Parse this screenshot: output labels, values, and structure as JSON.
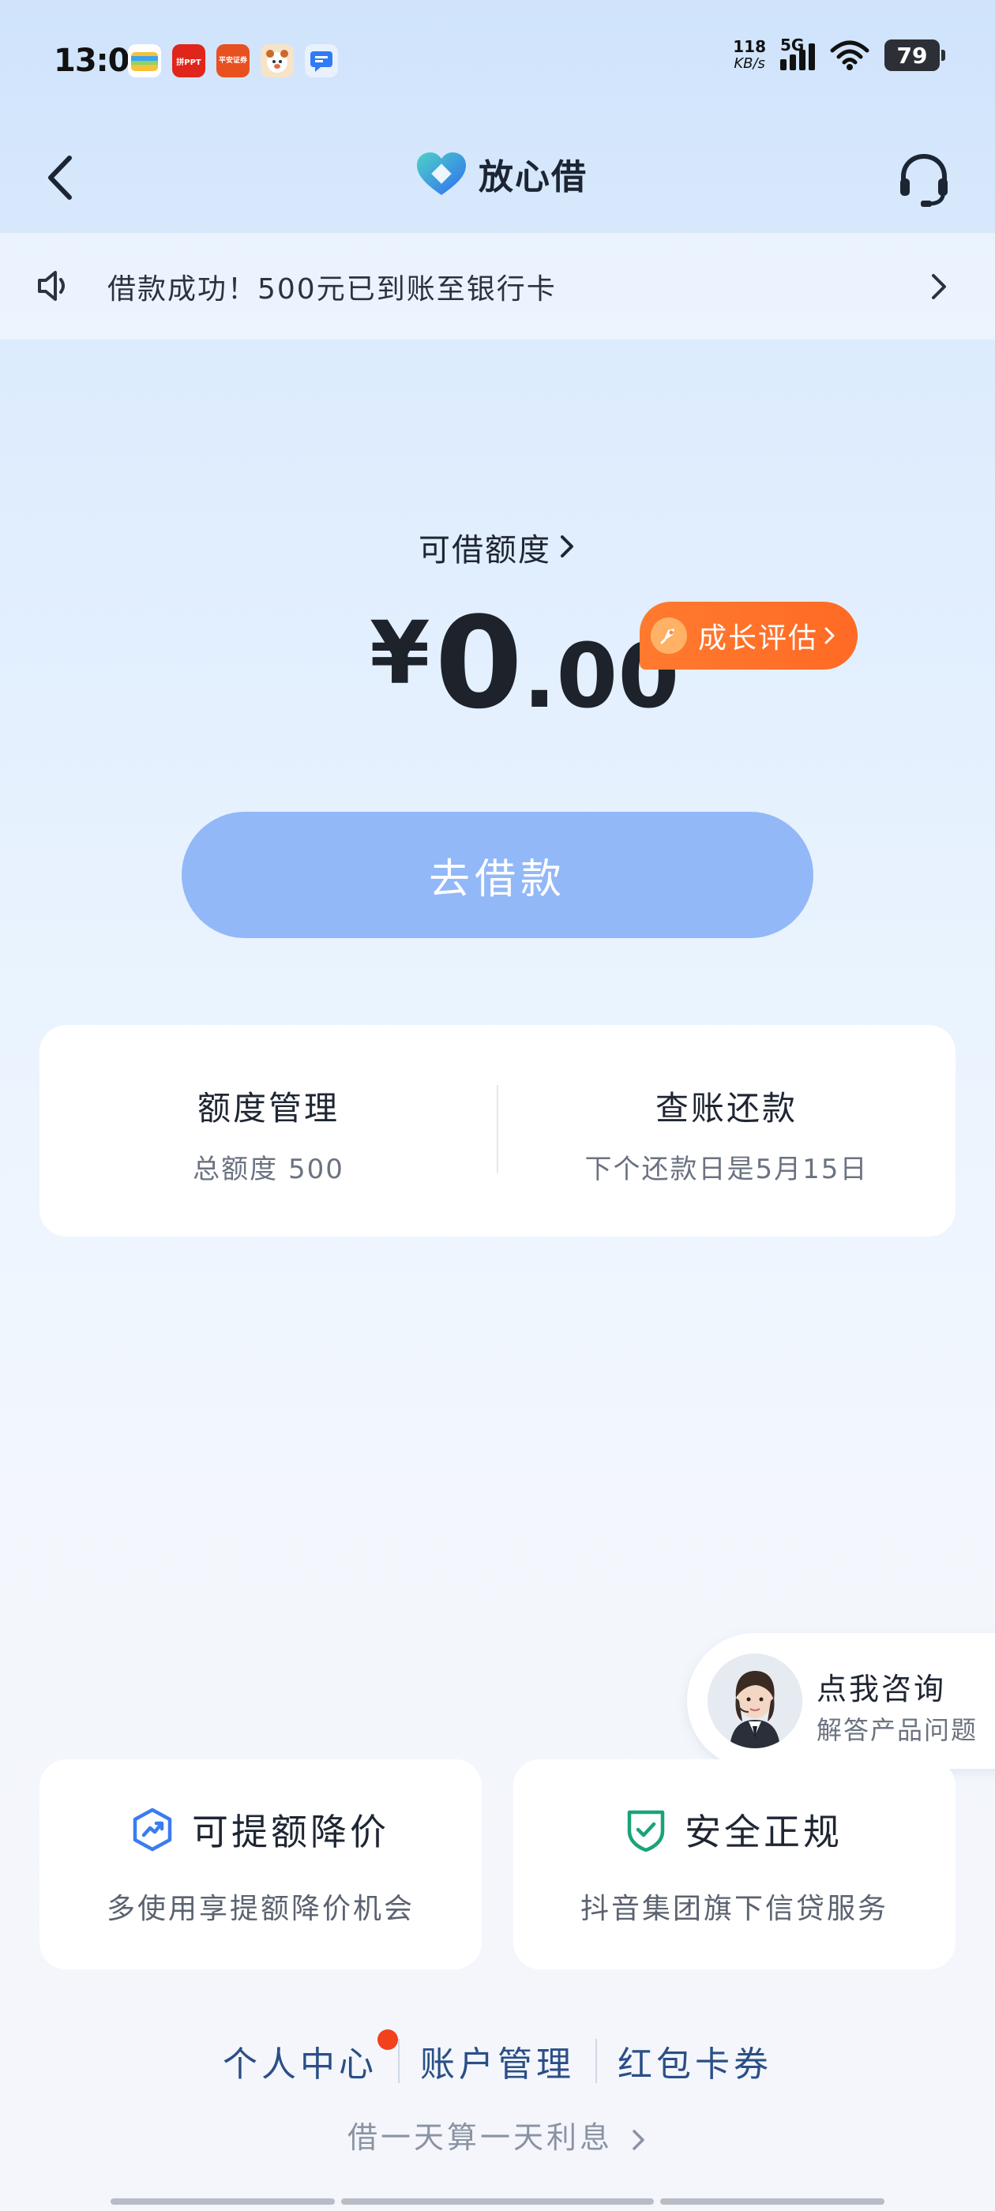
{
  "status_bar": {
    "time": "13:01",
    "net_speed_value": "118",
    "net_speed_unit": "KB/s",
    "network": "5G",
    "battery": "79",
    "apps": [
      {
        "name": "wallet-app-icon",
        "color": "#f5c23a"
      },
      {
        "name": "pdd-app-icon",
        "color": "#e0261a",
        "label": "拼PPT"
      },
      {
        "name": "pingan-securities-app-icon",
        "color": "#e8501f",
        "label": "平安证券"
      },
      {
        "name": "bear-app-icon",
        "color": "#f3d3b0"
      },
      {
        "name": "message-app-icon",
        "color": "#2f7bf4"
      }
    ]
  },
  "header": {
    "brand_name": "放心借"
  },
  "notice": {
    "text": "借款成功！500元已到账至银行卡"
  },
  "limit": {
    "label": "可借额度",
    "currency": "¥",
    "amount_int": "0",
    "amount_dec": ".00",
    "growth_label": "成长评估"
  },
  "borrow_button": "去借款",
  "management": {
    "left_title": "额度管理",
    "left_sub": "总额度 500",
    "right_title": "查账还款",
    "right_sub": "下个还款日是5月15日"
  },
  "consult": {
    "title": "点我咨询",
    "sub": "解答产品问题"
  },
  "features": [
    {
      "title": "可提额降价",
      "sub": "多使用享提额降价机会",
      "icon": "trend-up-icon",
      "color": "#3b7cf0"
    },
    {
      "title": "安全正规",
      "sub": "抖音集团旗下信贷服务",
      "icon": "shield-check-icon",
      "color": "#1aa37a"
    }
  ],
  "bottom_links": [
    "个人中心",
    "账户管理",
    "红包卡券"
  ],
  "slogan": "借一天算一天利息",
  "colors": {
    "accent_blue": "#93b8f7",
    "orange": "#ff6a25",
    "link_blue": "#2a4f86"
  }
}
